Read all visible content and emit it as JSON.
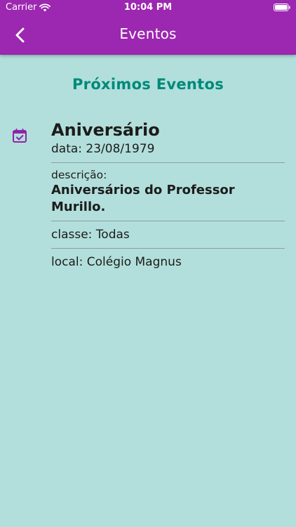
{
  "status_bar": {
    "carrier": "Carrier",
    "time": "10:04 PM",
    "icons": [
      "wifi-icon",
      "battery-icon"
    ]
  },
  "nav": {
    "title": "Eventos",
    "back_icon": "chevron-left-icon"
  },
  "colors": {
    "header": "#9c27b0",
    "background": "#b2dfdb",
    "section_title": "#00897b",
    "event_icon": "#8e24aa"
  },
  "section_title": "Próximos Eventos",
  "event": {
    "icon": "calendar-check-icon",
    "title": "Aniversário",
    "date": "data: 23/08/1979",
    "description_label": "descrição:",
    "description_value": "Aniversários do Professor Murillo.",
    "class": "classe: Todas",
    "location": "local: Colégio Magnus"
  }
}
